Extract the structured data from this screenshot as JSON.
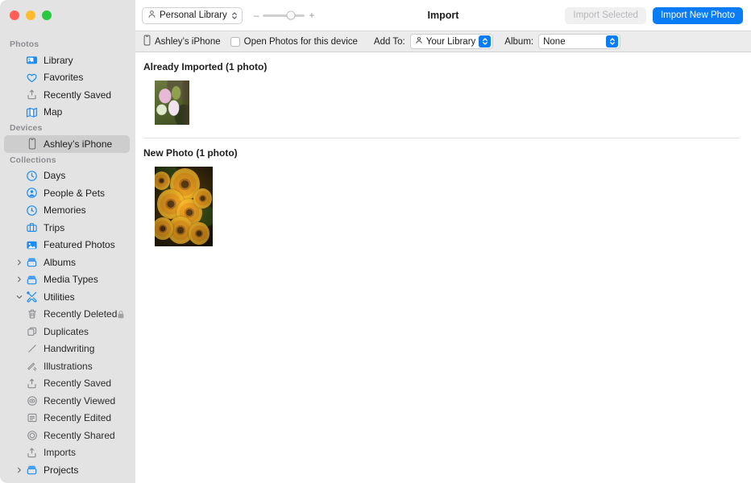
{
  "window": {
    "title": "Import",
    "traffic_lights": [
      "close",
      "minimize",
      "zoom"
    ]
  },
  "toolbar": {
    "library_button": "Personal Library",
    "library_icon": "person-icon",
    "zoom_out_label": "–",
    "zoom_in_label": "+",
    "zoom_value": 66,
    "import_selected_label": "Import Selected",
    "import_selected_enabled": false,
    "import_new_photo_label": "Import New Photo",
    "accent_color": "#0a7cf6"
  },
  "import_bar": {
    "device_name": "Ashley’s iPhone",
    "device_icon": "iphone-icon",
    "open_photos_label": "Open Photos for this device",
    "open_photos_checked": false,
    "add_to_label": "Add To:",
    "add_to_value": "Your Library",
    "add_to_icon": "person-icon",
    "album_label": "Album:",
    "album_value": "None"
  },
  "sidebar": {
    "sections": [
      {
        "header": "Photos",
        "items": [
          {
            "label": "Library",
            "icon": "library-icon",
            "indent": 0,
            "selected": false
          },
          {
            "label": "Favorites",
            "icon": "heart-icon",
            "indent": 0,
            "selected": false
          },
          {
            "label": "Recently Saved",
            "icon": "tray-arrow-up-icon",
            "indent": 0,
            "selected": false
          },
          {
            "label": "Map",
            "icon": "map-icon",
            "indent": 0,
            "selected": false
          }
        ]
      },
      {
        "header": "Devices",
        "items": [
          {
            "label": "Ashley’s iPhone",
            "icon": "iphone-icon",
            "indent": 0,
            "selected": true
          }
        ]
      },
      {
        "header": "Collections",
        "items": [
          {
            "label": "Days",
            "icon": "clock-icon",
            "indent": 0,
            "selected": false
          },
          {
            "label": "People & Pets",
            "icon": "person-circle-icon",
            "indent": 0,
            "selected": false
          },
          {
            "label": "Memories",
            "icon": "memories-icon",
            "indent": 0,
            "selected": false
          },
          {
            "label": "Trips",
            "icon": "suitcase-icon",
            "indent": 0,
            "selected": false
          },
          {
            "label": "Featured Photos",
            "icon": "photo-icon",
            "indent": 0,
            "selected": false
          },
          {
            "label": "Albums",
            "icon": "album-icon",
            "indent": 0,
            "selected": false,
            "twisty": "collapsed"
          },
          {
            "label": "Media Types",
            "icon": "album-icon",
            "indent": 0,
            "selected": false,
            "twisty": "collapsed"
          },
          {
            "label": "Utilities",
            "icon": "tools-icon",
            "indent": 0,
            "selected": false,
            "twisty": "expanded"
          },
          {
            "label": "Recently Deleted",
            "icon": "trash-icon",
            "indent": 1,
            "selected": false,
            "lock": true
          },
          {
            "label": "Duplicates",
            "icon": "duplicate-icon",
            "indent": 1,
            "selected": false
          },
          {
            "label": "Handwriting",
            "icon": "pencil-line-icon",
            "indent": 1,
            "selected": false
          },
          {
            "label": "Illustrations",
            "icon": "illustration-icon",
            "indent": 1,
            "selected": false
          },
          {
            "label": "Recently Saved",
            "icon": "tray-arrow-up-icon",
            "indent": 1,
            "selected": false
          },
          {
            "label": "Recently Viewed",
            "icon": "eye-circle-icon",
            "indent": 1,
            "selected": false
          },
          {
            "label": "Recently Edited",
            "icon": "edit-box-icon",
            "indent": 1,
            "selected": false
          },
          {
            "label": "Recently Shared",
            "icon": "share-circle-icon",
            "indent": 1,
            "selected": false
          },
          {
            "label": "Imports",
            "icon": "tray-arrow-up-icon",
            "indent": 1,
            "selected": false
          },
          {
            "label": "Projects",
            "icon": "album-icon",
            "indent": 0,
            "selected": false,
            "twisty": "collapsed"
          }
        ]
      }
    ]
  },
  "content": {
    "groups": [
      {
        "title": "Already Imported (1 photo)",
        "photos": [
          {
            "alt": "pink-flowers-garden-photo",
            "size": "small"
          }
        ]
      },
      {
        "title": "New Photo (1 photo)",
        "photos": [
          {
            "alt": "orange-black-eyed-susan-flowers-photo",
            "size": "big"
          }
        ]
      }
    ]
  }
}
